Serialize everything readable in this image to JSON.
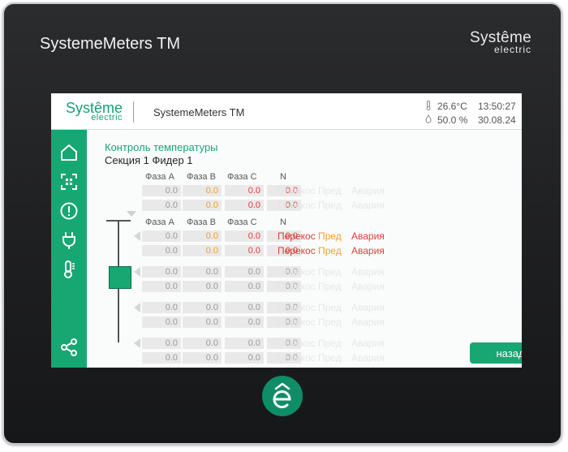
{
  "device": {
    "title": "SystemeMeters TM",
    "logo_line1": "Systême",
    "logo_line2": "electric"
  },
  "topbar": {
    "logo_line1": "Systême",
    "logo_line2": "electric",
    "app_title": "SystemeMeters TM",
    "temperature": "26.6°C",
    "humidity": "50.0 %",
    "time": "13:50:27",
    "date": "30.08.24"
  },
  "sidebar": {
    "items": [
      {
        "icon": "home-icon"
      },
      {
        "icon": "scan-icon"
      },
      {
        "icon": "alert-icon"
      },
      {
        "icon": "plug-icon"
      },
      {
        "icon": "thermometer-icon"
      },
      {
        "icon": "share-icon"
      }
    ]
  },
  "content": {
    "heading": "Контроль температуры",
    "subheading": "Секция 1 Фидер 1",
    "column_headers": [
      "Фаза A",
      "Фаза B",
      "Фаза C",
      "N"
    ],
    "alarm_labels": [
      "Перекос",
      "Пред",
      "Авария"
    ],
    "groups": [
      {
        "has_header": true,
        "active": false,
        "rows": [
          [
            "0.0",
            "0.0",
            "0.0",
            "0.0"
          ],
          [
            "0.0",
            "0.0",
            "0.0",
            "0.0"
          ]
        ]
      },
      {
        "has_header": true,
        "active": true,
        "rows": [
          [
            "0.0",
            "0.0",
            "0.0",
            "0.0"
          ],
          [
            "0.0",
            "0.0",
            "0.0",
            "0.0"
          ]
        ]
      },
      {
        "has_header": false,
        "active": false,
        "rows": [
          [
            "0.0",
            "0.0",
            "0.0",
            "0.0"
          ],
          [
            "0.0",
            "0.0",
            "0.0",
            "0.0"
          ]
        ]
      },
      {
        "has_header": false,
        "active": false,
        "rows": [
          [
            "0.0",
            "0.0",
            "0.0",
            "0.0"
          ],
          [
            "0.0",
            "0.0",
            "0.0",
            "0.0"
          ]
        ]
      },
      {
        "has_header": false,
        "active": false,
        "rows": [
          [
            "0.0",
            "0.0",
            "0.0",
            "0.0"
          ],
          [
            "0.0",
            "0.0",
            "0.0",
            "0.0"
          ]
        ]
      }
    ],
    "back_label": "назад"
  },
  "colors": {
    "accent": "#16a773",
    "phase_b": "#f0a028",
    "phase_c": "#e03c3c",
    "neutral": "#e03c3c",
    "muted_value": "#9a9a9a",
    "faded_alarm": "#e6e6e6"
  }
}
